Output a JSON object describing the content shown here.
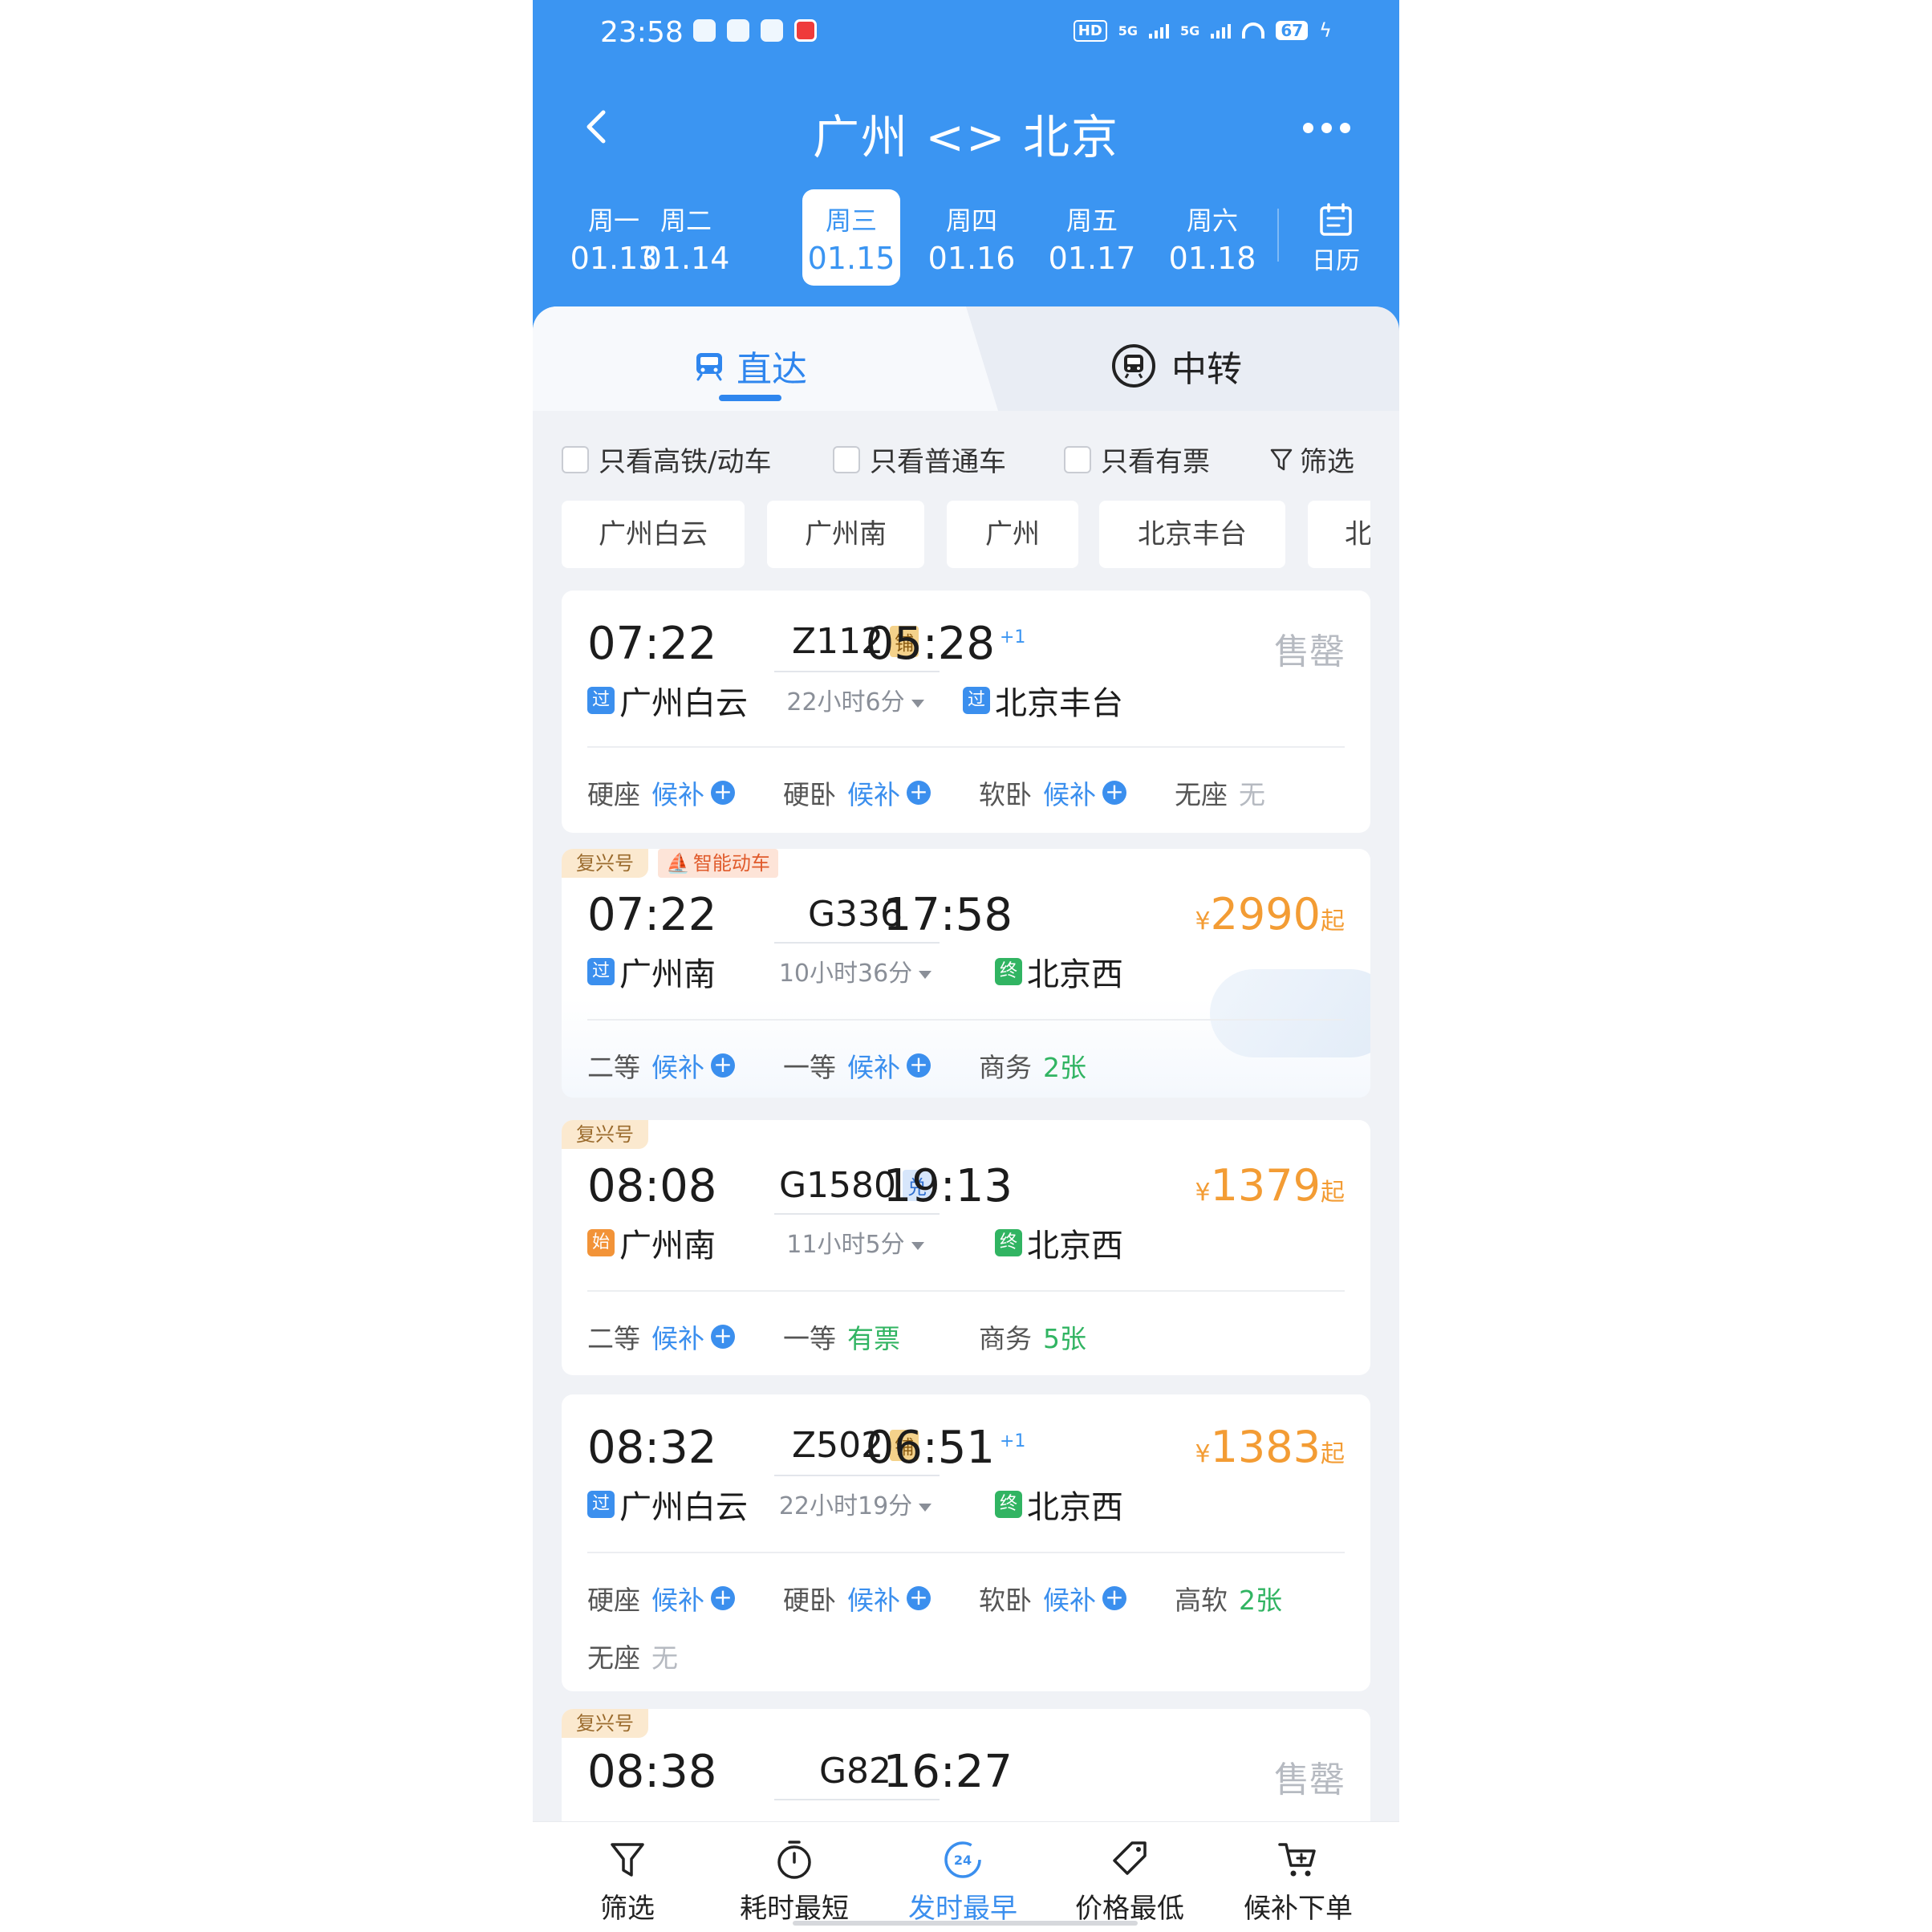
{
  "status_bar": {
    "time": "23:58",
    "hd": "HD",
    "net1": "5G",
    "net2": "5G",
    "battery": "67",
    "icons": [
      "wechat-icon",
      "message-icon",
      "u-app-icon",
      "red-app-icon",
      "wifi-icon",
      "battery-icon",
      "charging-icon"
    ]
  },
  "nav": {
    "title": "广州 <> 北京"
  },
  "dates": [
    {
      "weekday": "周一",
      "date": "01.13",
      "active": false
    },
    {
      "weekday": "周二",
      "date": "01.14",
      "active": false
    },
    {
      "weekday": "周三",
      "date": "01.15",
      "active": true
    },
    {
      "weekday": "周四",
      "date": "01.16",
      "active": false
    },
    {
      "weekday": "周五",
      "date": "01.17",
      "active": false
    },
    {
      "weekday": "周六",
      "date": "01.18",
      "active": false
    }
  ],
  "calendar_label": "日历",
  "tabs": {
    "direct": "直达",
    "transfer": "中转"
  },
  "filters": {
    "high_speed": "只看高铁/动车",
    "normal": "只看普通车",
    "available": "只看有票",
    "filter": "筛选"
  },
  "stations": [
    "广州白云",
    "广州南",
    "广州",
    "北京丰台",
    "北"
  ],
  "trains": [
    {
      "dep_time": "07:22",
      "train_no": "Z112",
      "tag": "铺",
      "arr_time": "05:28",
      "plus_day": "+1",
      "duration": "22小时6分",
      "dep_tag": "过",
      "dep_station": "广州白云",
      "arr_tag": "过",
      "arr_station": "北京丰台",
      "status": "售罄",
      "seats": [
        {
          "name": "硬座",
          "value": "候补"
        },
        {
          "name": "硬卧",
          "value": "候补"
        },
        {
          "name": "软卧",
          "value": "候补"
        },
        {
          "name": "无座",
          "value": "无"
        }
      ]
    },
    {
      "badges": [
        "复兴号",
        "智能动车"
      ],
      "dep_time": "07:22",
      "train_no": "G336",
      "arr_time": "17:58",
      "duration": "10小时36分",
      "dep_tag": "过",
      "dep_station": "广州南",
      "arr_tag": "终",
      "arr_station": "北京西",
      "price_symbol": "¥",
      "price": "2990",
      "price_suffix": "起",
      "seats": [
        {
          "name": "二等",
          "value": "候补"
        },
        {
          "name": "一等",
          "value": "候补"
        },
        {
          "name": "商务",
          "value": "2张"
        }
      ]
    },
    {
      "badges": [
        "复兴号"
      ],
      "dep_time": "08:08",
      "train_no": "G1580",
      "tag": "兑",
      "arr_time": "19:13",
      "duration": "11小时5分",
      "dep_tag": "始",
      "dep_station": "广州南",
      "arr_tag": "终",
      "arr_station": "北京西",
      "price_symbol": "¥",
      "price": "1379",
      "price_suffix": "起",
      "seats": [
        {
          "name": "二等",
          "value": "候补"
        },
        {
          "name": "一等",
          "value": "有票"
        },
        {
          "name": "商务",
          "value": "5张"
        }
      ]
    },
    {
      "dep_time": "08:32",
      "train_no": "Z502",
      "tag": "铺",
      "arr_time": "06:51",
      "plus_day": "+1",
      "duration": "22小时19分",
      "dep_tag": "过",
      "dep_station": "广州白云",
      "arr_tag": "终",
      "arr_station": "北京西",
      "price_symbol": "¥",
      "price": "1383",
      "price_suffix": "起",
      "seats": [
        {
          "name": "硬座",
          "value": "候补"
        },
        {
          "name": "硬卧",
          "value": "候补"
        },
        {
          "name": "软卧",
          "value": "候补"
        },
        {
          "name": "高软",
          "value": "2张"
        },
        {
          "name": "无座",
          "value": "无"
        }
      ]
    },
    {
      "badges": [
        "复兴号"
      ],
      "dep_time": "08:38",
      "train_no": "G82",
      "arr_time": "16:27",
      "status": "售罄"
    }
  ],
  "bottom_nav": [
    {
      "label": "筛选",
      "icon": "filter-icon",
      "active": false
    },
    {
      "label": "耗时最短",
      "icon": "stopwatch-icon",
      "active": false
    },
    {
      "label": "发时最早",
      "icon": "clock-24-icon",
      "icon_text": "24",
      "active": true
    },
    {
      "label": "价格最低",
      "icon": "price-tag-icon",
      "active": false
    },
    {
      "label": "候补下单",
      "icon": "cart-icon",
      "active": false
    }
  ],
  "colors": {
    "header_blue": "#3b95f2",
    "accent_blue": "#3b8fee",
    "price_orange": "#f39c34",
    "available_green": "#31b462",
    "sold_gray": "#b6bac1"
  }
}
